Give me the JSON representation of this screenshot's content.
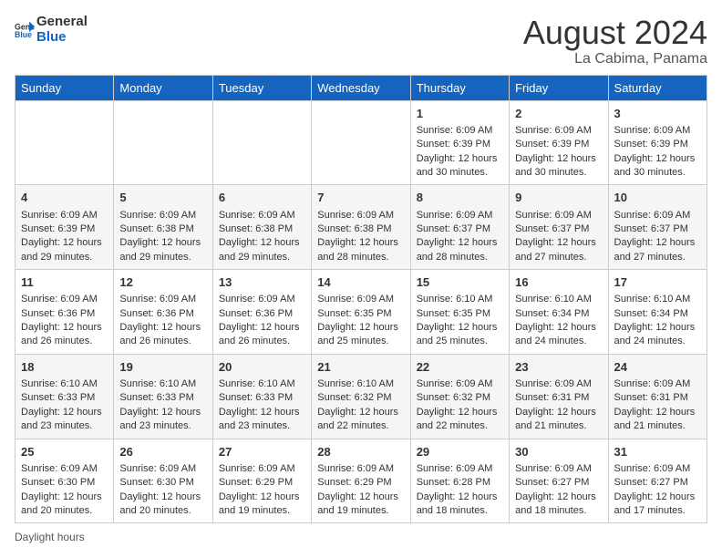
{
  "header": {
    "logo_general": "General",
    "logo_blue": "Blue",
    "month_year": "August 2024",
    "location": "La Cabima, Panama"
  },
  "days_of_week": [
    "Sunday",
    "Monday",
    "Tuesday",
    "Wednesday",
    "Thursday",
    "Friday",
    "Saturday"
  ],
  "weeks": [
    [
      {
        "day": "",
        "info": ""
      },
      {
        "day": "",
        "info": ""
      },
      {
        "day": "",
        "info": ""
      },
      {
        "day": "",
        "info": ""
      },
      {
        "day": "1",
        "info": "Sunrise: 6:09 AM\nSunset: 6:39 PM\nDaylight: 12 hours and 30 minutes."
      },
      {
        "day": "2",
        "info": "Sunrise: 6:09 AM\nSunset: 6:39 PM\nDaylight: 12 hours and 30 minutes."
      },
      {
        "day": "3",
        "info": "Sunrise: 6:09 AM\nSunset: 6:39 PM\nDaylight: 12 hours and 30 minutes."
      }
    ],
    [
      {
        "day": "4",
        "info": "Sunrise: 6:09 AM\nSunset: 6:39 PM\nDaylight: 12 hours and 29 minutes."
      },
      {
        "day": "5",
        "info": "Sunrise: 6:09 AM\nSunset: 6:38 PM\nDaylight: 12 hours and 29 minutes."
      },
      {
        "day": "6",
        "info": "Sunrise: 6:09 AM\nSunset: 6:38 PM\nDaylight: 12 hours and 29 minutes."
      },
      {
        "day": "7",
        "info": "Sunrise: 6:09 AM\nSunset: 6:38 PM\nDaylight: 12 hours and 28 minutes."
      },
      {
        "day": "8",
        "info": "Sunrise: 6:09 AM\nSunset: 6:37 PM\nDaylight: 12 hours and 28 minutes."
      },
      {
        "day": "9",
        "info": "Sunrise: 6:09 AM\nSunset: 6:37 PM\nDaylight: 12 hours and 27 minutes."
      },
      {
        "day": "10",
        "info": "Sunrise: 6:09 AM\nSunset: 6:37 PM\nDaylight: 12 hours and 27 minutes."
      }
    ],
    [
      {
        "day": "11",
        "info": "Sunrise: 6:09 AM\nSunset: 6:36 PM\nDaylight: 12 hours and 26 minutes."
      },
      {
        "day": "12",
        "info": "Sunrise: 6:09 AM\nSunset: 6:36 PM\nDaylight: 12 hours and 26 minutes."
      },
      {
        "day": "13",
        "info": "Sunrise: 6:09 AM\nSunset: 6:36 PM\nDaylight: 12 hours and 26 minutes."
      },
      {
        "day": "14",
        "info": "Sunrise: 6:09 AM\nSunset: 6:35 PM\nDaylight: 12 hours and 25 minutes."
      },
      {
        "day": "15",
        "info": "Sunrise: 6:10 AM\nSunset: 6:35 PM\nDaylight: 12 hours and 25 minutes."
      },
      {
        "day": "16",
        "info": "Sunrise: 6:10 AM\nSunset: 6:34 PM\nDaylight: 12 hours and 24 minutes."
      },
      {
        "day": "17",
        "info": "Sunrise: 6:10 AM\nSunset: 6:34 PM\nDaylight: 12 hours and 24 minutes."
      }
    ],
    [
      {
        "day": "18",
        "info": "Sunrise: 6:10 AM\nSunset: 6:33 PM\nDaylight: 12 hours and 23 minutes."
      },
      {
        "day": "19",
        "info": "Sunrise: 6:10 AM\nSunset: 6:33 PM\nDaylight: 12 hours and 23 minutes."
      },
      {
        "day": "20",
        "info": "Sunrise: 6:10 AM\nSunset: 6:33 PM\nDaylight: 12 hours and 23 minutes."
      },
      {
        "day": "21",
        "info": "Sunrise: 6:10 AM\nSunset: 6:32 PM\nDaylight: 12 hours and 22 minutes."
      },
      {
        "day": "22",
        "info": "Sunrise: 6:09 AM\nSunset: 6:32 PM\nDaylight: 12 hours and 22 minutes."
      },
      {
        "day": "23",
        "info": "Sunrise: 6:09 AM\nSunset: 6:31 PM\nDaylight: 12 hours and 21 minutes."
      },
      {
        "day": "24",
        "info": "Sunrise: 6:09 AM\nSunset: 6:31 PM\nDaylight: 12 hours and 21 minutes."
      }
    ],
    [
      {
        "day": "25",
        "info": "Sunrise: 6:09 AM\nSunset: 6:30 PM\nDaylight: 12 hours and 20 minutes."
      },
      {
        "day": "26",
        "info": "Sunrise: 6:09 AM\nSunset: 6:30 PM\nDaylight: 12 hours and 20 minutes."
      },
      {
        "day": "27",
        "info": "Sunrise: 6:09 AM\nSunset: 6:29 PM\nDaylight: 12 hours and 19 minutes."
      },
      {
        "day": "28",
        "info": "Sunrise: 6:09 AM\nSunset: 6:29 PM\nDaylight: 12 hours and 19 minutes."
      },
      {
        "day": "29",
        "info": "Sunrise: 6:09 AM\nSunset: 6:28 PM\nDaylight: 12 hours and 18 minutes."
      },
      {
        "day": "30",
        "info": "Sunrise: 6:09 AM\nSunset: 6:27 PM\nDaylight: 12 hours and 18 minutes."
      },
      {
        "day": "31",
        "info": "Sunrise: 6:09 AM\nSunset: 6:27 PM\nDaylight: 12 hours and 17 minutes."
      }
    ]
  ],
  "footer": {
    "note": "Daylight hours"
  }
}
